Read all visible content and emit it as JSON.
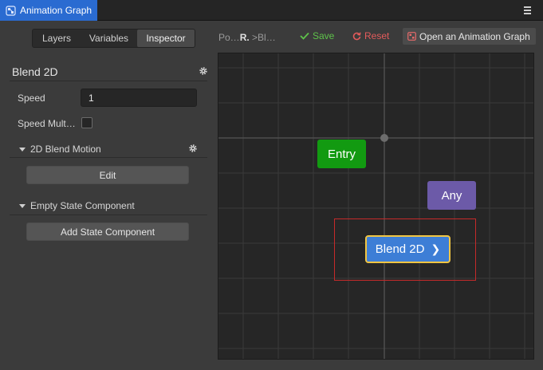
{
  "window": {
    "tab_title": "Animation Graph",
    "menu_icon": "hamburger-menu-icon"
  },
  "inspector_tabs": [
    "Layers",
    "Variables",
    "Inspector"
  ],
  "active_tab": "Inspector",
  "state": {
    "title": "Blend 2D",
    "speed_label": "Speed",
    "speed_value": "1",
    "speed_multiplier_label": "Speed Mult…",
    "speed_multiplier_checked": false
  },
  "motion_group": {
    "title": "2D Blend Motion",
    "edit_label": "Edit"
  },
  "state_component_group": {
    "title": "Empty State Component",
    "add_label": "Add State Component"
  },
  "toolbar": {
    "crumb_1": "Po…",
    "crumb_2": "R.",
    "crumb_sep": ">",
    "crumb_3": "Bl…",
    "save_label": "Save",
    "reset_label": "Reset",
    "open_label": "Open an Animation Graph"
  },
  "graph": {
    "nodes": {
      "entry": "Entry",
      "any": "Any",
      "blend": "Blend 2D"
    },
    "colors": {
      "entry": "#129a11",
      "any": "#6c5aa8",
      "blend": "#3d7ed6",
      "selected_border": "#f1c542",
      "selection_rect": "#c62a2a"
    }
  },
  "colors": {
    "accent": "#2a6bd1",
    "save": "#5ec24a",
    "reset": "#e35b5b"
  }
}
